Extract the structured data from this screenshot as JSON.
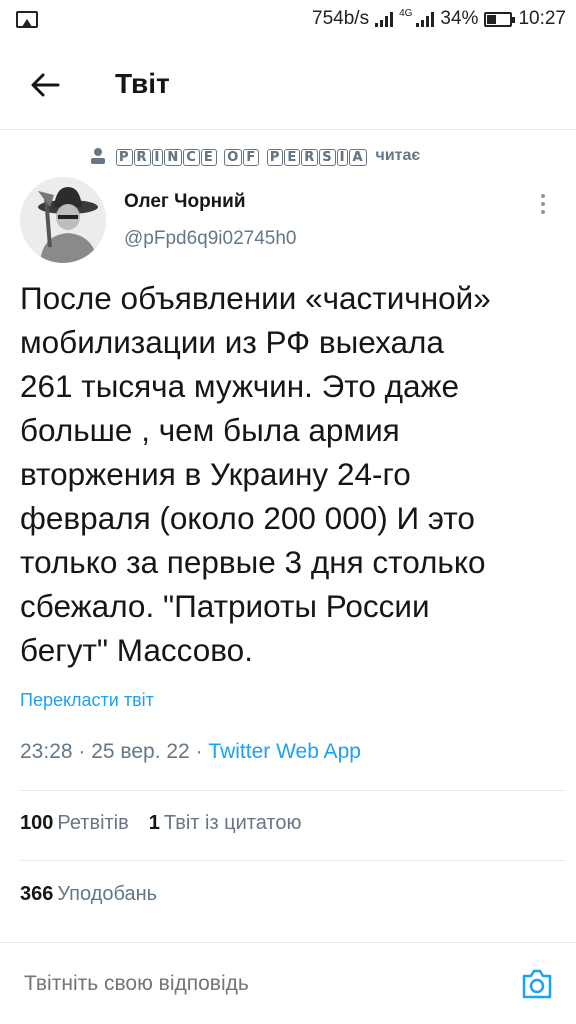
{
  "status_bar": {
    "speed": "754b/s",
    "network": "4G",
    "battery": "34%",
    "time": "10:27"
  },
  "header": {
    "title": "Твіт"
  },
  "context": {
    "name": "PRINCE OF PERSIA",
    "suffix": "читає"
  },
  "author": {
    "name": "Олег Чорний",
    "handle": "@pFpd6q9i02745h0"
  },
  "tweet": {
    "text": "После объявлении «частичной»\nмобилизации из РФ выехала\n261 тысяча мужчин. Это даже\nбольше , чем была армия\nвторжения в Украину 24-го\nфевраля (около 200 000) И это\nтолько за первые 3 дня столько\nсбежало. \"Патриоты России\nбегут\" Массово.",
    "translate_label": "Перекласти твіт",
    "time": "23:28",
    "date": "25 вер. 22",
    "app": "Twitter Web App"
  },
  "stats": {
    "retweets_count": "100",
    "retweets_label": "Ретвітів",
    "quotes_count": "1",
    "quotes_label": "Твіт із цитатою",
    "likes_count": "366",
    "likes_label": "Уподобань"
  },
  "reply": {
    "placeholder": "Твітніть свою відповідь"
  },
  "colors": {
    "accent": "#1da1f2",
    "secondary_text": "#657786",
    "primary_text": "#14171a"
  }
}
